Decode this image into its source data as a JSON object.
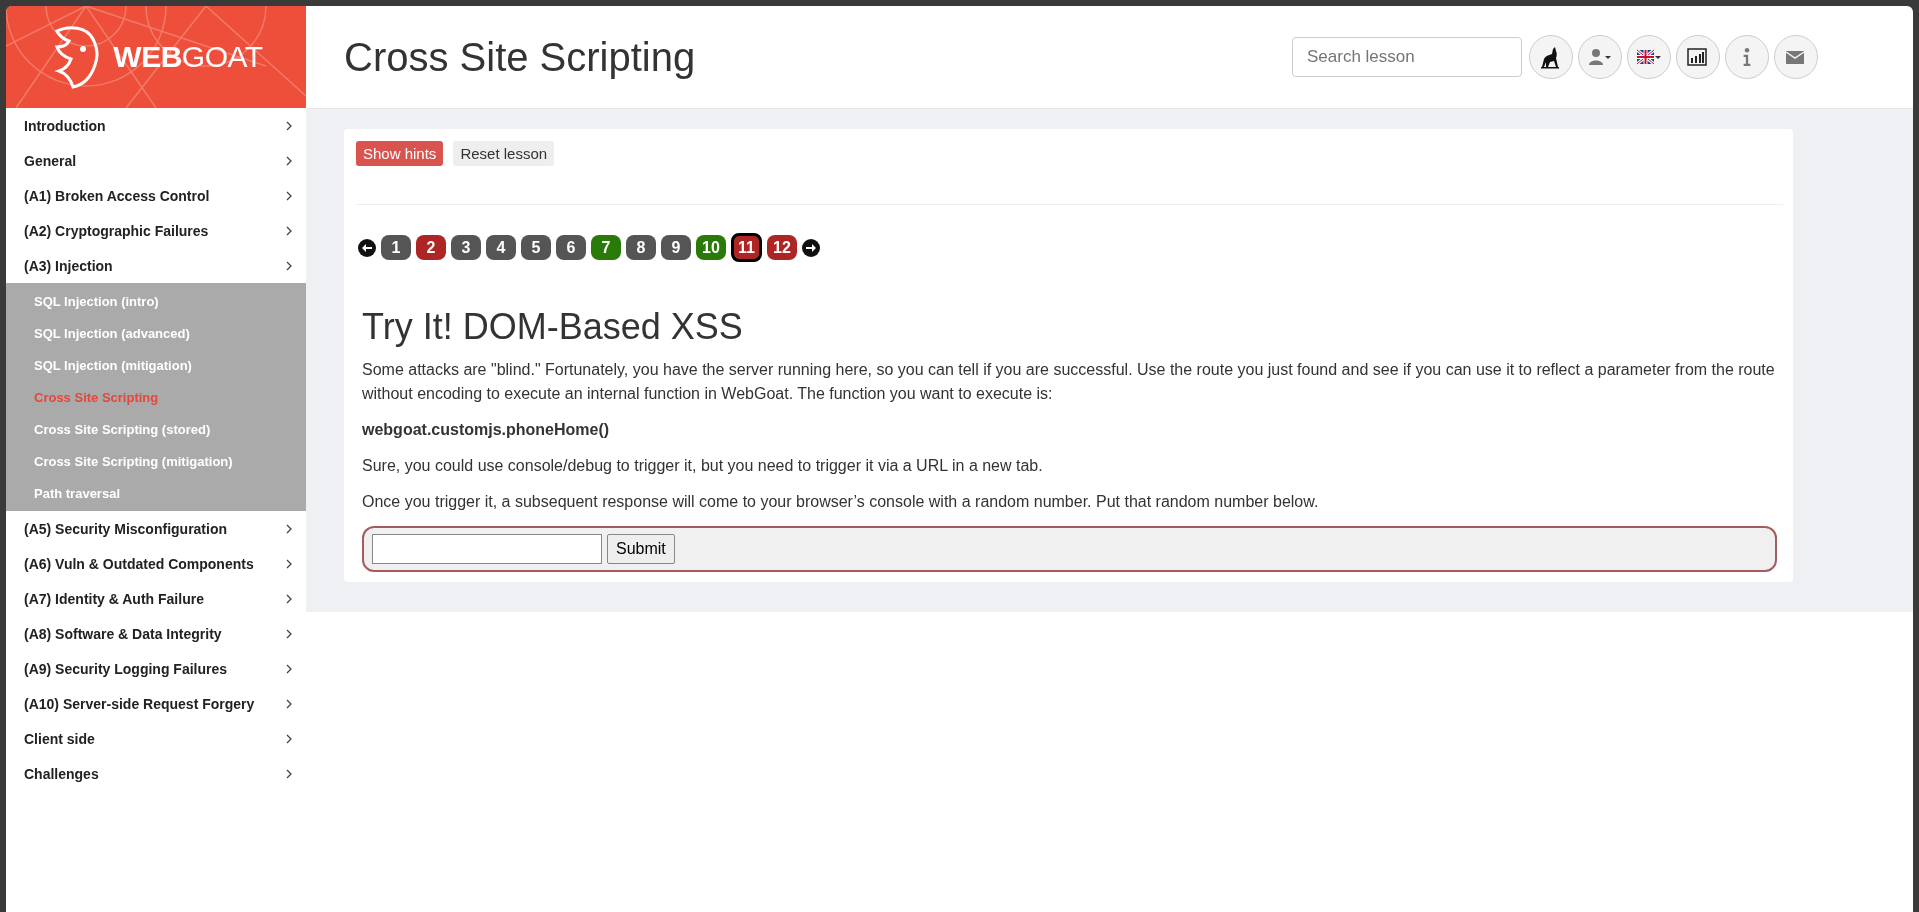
{
  "logo": {
    "text_bold": "WEB",
    "text_light": "GOAT"
  },
  "header": {
    "title": "Cross Site Scripting",
    "search": {
      "placeholder": "Search lesson"
    },
    "buttons": [
      {
        "kind": "wolf"
      },
      {
        "kind": "user"
      },
      {
        "kind": "flag"
      },
      {
        "kind": "chart"
      },
      {
        "kind": "info"
      },
      {
        "kind": "mail"
      }
    ]
  },
  "sidebar": {
    "items": [
      {
        "label": "Introduction"
      },
      {
        "label": "General"
      },
      {
        "label": "(A1) Broken Access Control"
      },
      {
        "label": "(A2) Cryptographic Failures"
      },
      {
        "label": "(A3) Injection",
        "children": [
          {
            "label": "SQL Injection (intro)",
            "selected": false
          },
          {
            "label": "SQL Injection (advanced)",
            "selected": false
          },
          {
            "label": "SQL Injection (mitigation)",
            "selected": false
          },
          {
            "label": "Cross Site Scripting",
            "selected": true
          },
          {
            "label": "Cross Site Scripting (stored)",
            "selected": false
          },
          {
            "label": "Cross Site Scripting (mitigation)",
            "selected": false
          },
          {
            "label": "Path traversal",
            "selected": false
          }
        ]
      },
      {
        "label": "(A5) Security Misconfiguration"
      },
      {
        "label": "(A6) Vuln & Outdated Components"
      },
      {
        "label": "(A7) Identity & Auth Failure"
      },
      {
        "label": "(A8) Software & Data Integrity"
      },
      {
        "label": "(A9) Security Logging Failures"
      },
      {
        "label": "(A10) Server-side Request Forgery"
      },
      {
        "label": "Client side"
      },
      {
        "label": "Challenges"
      }
    ]
  },
  "lesson": {
    "buttons": [
      {
        "label": "Show hints",
        "kind": "danger"
      },
      {
        "label": "Reset lesson",
        "kind": "default"
      }
    ],
    "pages": [
      {
        "label": "1",
        "color": "#555555",
        "selected": false
      },
      {
        "label": "2",
        "color": "#ad2525",
        "selected": false
      },
      {
        "label": "3",
        "color": "#555555",
        "selected": false
      },
      {
        "label": "4",
        "color": "#555555",
        "selected": false
      },
      {
        "label": "5",
        "color": "#555555",
        "selected": false
      },
      {
        "label": "6",
        "color": "#555555",
        "selected": false
      },
      {
        "label": "7",
        "color": "#2a7a09",
        "selected": false
      },
      {
        "label": "8",
        "color": "#555555",
        "selected": false
      },
      {
        "label": "9",
        "color": "#555555",
        "selected": false
      },
      {
        "label": "10",
        "color": "#2a7a09",
        "selected": false
      },
      {
        "label": "11",
        "color": "#ad2525",
        "selected": true
      },
      {
        "label": "12",
        "color": "#ad2525",
        "selected": false
      }
    ],
    "heading": "Try It! DOM-Based XSS",
    "paragraphs": [
      {
        "kind": "text",
        "text": "Some attacks are \"blind.\" Fortunately, you have the server running here, so you can tell if you are successful. Use the route you just found and see if you can use it to reflect a parameter from the route without encoding to execute an internal function in WebGoat. The function you want to execute is:"
      },
      {
        "kind": "bold",
        "text": "webgoat.customjs.phoneHome()"
      },
      {
        "kind": "text",
        "text": "Sure, you could use console/debug to trigger it, but you need to trigger it via a URL in a new tab."
      },
      {
        "kind": "text",
        "text": "Once you trigger it, a subsequent response will come to your browser’s console with a random number. Put that random number below."
      }
    ],
    "form": {
      "submit": "Submit"
    }
  }
}
